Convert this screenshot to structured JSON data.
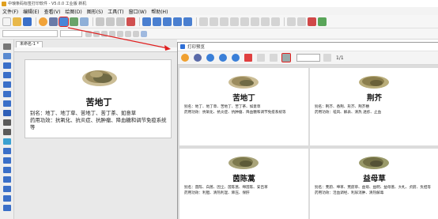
{
  "window": {
    "title": "中琅条码标签打印软件 - V5.0.0 工业版 新机"
  },
  "menu": {
    "items": [
      "文件(F)",
      "编辑(E)",
      "查看(V)",
      "绘图(D)",
      "图形(S)",
      "工具(T)",
      "窗口(W)",
      "帮助(H)"
    ]
  },
  "toolbar": {
    "print_preview_icon": "print-preview-icon"
  },
  "document": {
    "tab_label": "未命名-1 *"
  },
  "label": {
    "name": "苦地丁",
    "alias": "别名：地丁、地丁草、苦地丁、苦丁茶、如意草",
    "effect": "药用功效：抗氧化、抗炎症、抗肿瘤、降血糖和调节免疫系统等"
  },
  "preview": {
    "title": "打印预览",
    "page_current": "1",
    "page_total": "1/1",
    "cards": [
      {
        "name": "苦地丁",
        "alias": "别名：地丁、地丁草、苦地丁、苦丁茶、如意草",
        "effect": "药用功效：抗氧化、抗炎症、抗肿瘤、降血糖和调节免疫系统等"
      },
      {
        "name": "荆芥",
        "alias": "别名：荆芥、香荆、形芥、荆芥穗",
        "effect": "药用功效：祛风、解表、清热 透疹、止血"
      },
      {
        "name": "茵陈蒿",
        "alias": "别名：茵陈、白蒿、因尘、茵陈蒿、绵茵陈、安吕草",
        "effect": "药用功效：利胆、清热利湿、降压、保肝"
      },
      {
        "name": "益母草",
        "alias": "别名：茺蔚、坤草、茺蔚草、益母、益明、益母蒿、大札、贞蔚、负担等",
        "effect": "药用功效：活血调经、利尿消肿、清热解毒"
      }
    ]
  },
  "colors": {
    "highlight": "#e02020",
    "arrow": "#e02020",
    "herb": "#8a7a52"
  }
}
